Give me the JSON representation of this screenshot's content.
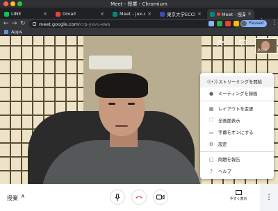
{
  "window": {
    "title": "Meet - 授業 - Chromium"
  },
  "tabs": [
    {
      "label": "LINE",
      "favicon_color": "#06c755",
      "active": false
    },
    {
      "label": "Gmail",
      "favicon_color": "#ea4335",
      "active": false
    },
    {
      "label": "Meet - jux-chwi",
      "favicon_color": "#00897b",
      "active": false
    },
    {
      "label": "東京大学ECCS",
      "favicon_color": "#3c4bb8",
      "active": false
    },
    {
      "label": "Meet - 授業",
      "favicon_color": "#00897b",
      "active": true
    }
  ],
  "toolbar": {
    "url_host": "meet.google.com",
    "url_path": "/crp-yvvu-ews",
    "profile_label": "Paused"
  },
  "bookmarks": {
    "apps_label": "Apps"
  },
  "meet": {
    "self_label": "あなた",
    "bottom": {
      "lesson_label": "授業",
      "present_label": "今すぐ表示"
    },
    "menu": {
      "items": [
        {
          "label": "ストリーミングを開始",
          "icon": "broadcast-icon"
        },
        {
          "label": "ミーティングを録画",
          "icon": "record-icon"
        },
        {
          "label": "レイアウトを変更",
          "icon": "layout-icon"
        },
        {
          "label": "全画面表示",
          "icon": "fullscreen-icon"
        },
        {
          "label": "字幕をオンにする",
          "icon": "captions-icon"
        },
        {
          "label": "設定",
          "icon": "gear-icon"
        },
        {
          "label": "問題を報告",
          "icon": "feedback-icon"
        },
        {
          "label": "ヘルプ",
          "icon": "help-icon"
        }
      ]
    }
  },
  "colors": {
    "hangup": "#ea4335",
    "paused_pill": "#8ab4f8"
  }
}
